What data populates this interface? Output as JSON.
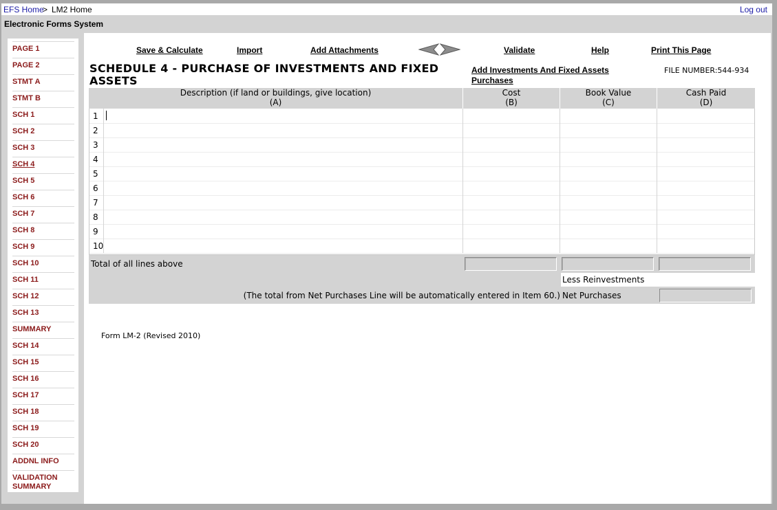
{
  "breadcrumb": {
    "home": "EFS Home",
    "separator": ">",
    "current": "LM2 Home",
    "logout": "Log out"
  },
  "system_name": "Electronic Forms System",
  "nav": {
    "items": [
      {
        "label": "PAGE 1"
      },
      {
        "label": "PAGE 2"
      },
      {
        "label": "STMT A"
      },
      {
        "label": "STMT B"
      },
      {
        "label": "SCH 1"
      },
      {
        "label": "SCH 2"
      },
      {
        "label": "SCH 3"
      },
      {
        "label": "SCH 4",
        "active": true
      },
      {
        "label": "SCH 5"
      },
      {
        "label": "SCH 6"
      },
      {
        "label": "SCH 7"
      },
      {
        "label": "SCH 8"
      },
      {
        "label": "SCH 9"
      },
      {
        "label": "SCH 10"
      },
      {
        "label": "SCH 11"
      },
      {
        "label": "SCH 12"
      },
      {
        "label": "SCH 13"
      },
      {
        "label": "SUMMARY"
      },
      {
        "label": "SCH 14"
      },
      {
        "label": "SCH 15"
      },
      {
        "label": "SCH 16"
      },
      {
        "label": "SCH 17"
      },
      {
        "label": "SCH 18"
      },
      {
        "label": "SCH 19"
      },
      {
        "label": "SCH 20"
      },
      {
        "label": "ADDNL INFO"
      },
      {
        "label": "VALIDATION SUMMARY"
      }
    ]
  },
  "toolbar": {
    "save": "Save & Calculate",
    "import": "Import",
    "attachments": "Add Attachments",
    "prev_icon": "left-arrow-icon",
    "next_icon": "right-arrow-icon",
    "validate": "Validate",
    "help": "Help",
    "print": "Print This Page"
  },
  "page": {
    "title": "SCHEDULE 4 - PURCHASE OF INVESTMENTS AND FIXED ASSETS",
    "add_link": "Add Investments And Fixed Assets Purchases",
    "file_number": "FILE NUMBER:544-934"
  },
  "table": {
    "columns": [
      {
        "label": "Description (if land or buildings, give location)",
        "code": "(A)"
      },
      {
        "label": "Cost",
        "code": "(B)"
      },
      {
        "label": "Book Value",
        "code": "(C)"
      },
      {
        "label": "Cash Paid",
        "code": "(D)"
      }
    ],
    "rows": [
      "1",
      "2",
      "3",
      "4",
      "5",
      "6",
      "7",
      "8",
      "9",
      "10"
    ],
    "total_label": "Total of all lines above",
    "less_label": "Less Reinvestments",
    "net_note": "(The total from Net Purchases Line will be automatically entered in Item 60.)",
    "net_label": "Net Purchases"
  },
  "footer": {
    "form_label": "Form LM-2 (Revised 2010)"
  }
}
